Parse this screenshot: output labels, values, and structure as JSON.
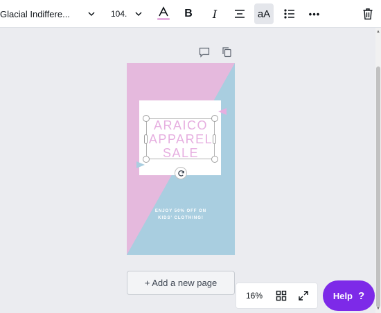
{
  "toolbar": {
    "font_name": "Glacial Indiffere...",
    "font_size": "104.",
    "icons": {
      "font_dropdown": "chevron-down-icon",
      "size_dropdown": "chevron-down-icon",
      "text_color": "text-color-icon",
      "bold": "B",
      "italic": "I",
      "align": "align-center-icon",
      "case": "aA",
      "list": "bulleted-list-icon",
      "more": "•••",
      "delete": "trash-icon"
    },
    "text_color_swatch": "#e6aee0",
    "case_active": true
  },
  "page_tools": {
    "comment": "comment-icon",
    "duplicate": "duplicate-icon"
  },
  "design": {
    "colors": {
      "pink": "#e5b9dd",
      "blue": "#a9cee0",
      "headline": "#e6aee0"
    },
    "headline_lines": [
      "ARAICO",
      "APPAREL",
      "SALE"
    ],
    "promo_lines": [
      "ENJOY 50% OFF ON",
      "KIDS' CLOTHING!"
    ]
  },
  "add_page": {
    "label": "+ Add a new page"
  },
  "zoom": {
    "value": "16%",
    "grid_icon": "grid-view-icon",
    "fullscreen_icon": "expand-icon"
  },
  "help": {
    "label": "Help",
    "icon": "?",
    "color": "#7d2ae8"
  }
}
